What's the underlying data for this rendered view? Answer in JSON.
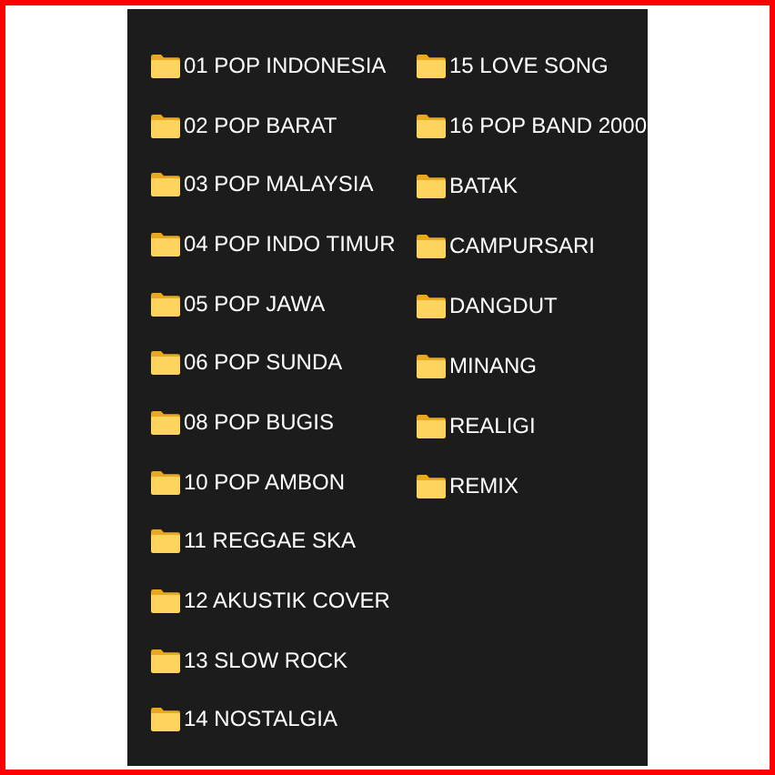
{
  "columns": [
    {
      "folders": [
        "01 POP INDONESIA",
        "02 POP BARAT",
        "03 POP MALAYSIA",
        "04 POP INDO TIMUR",
        "05 POP JAWA",
        "06 POP SUNDA",
        "08 POP BUGIS",
        "10 POP AMBON",
        "11 REGGAE SKA",
        "12 AKUSTIK COVER",
        "13 SLOW ROCK",
        "14 NOSTALGIA"
      ]
    },
    {
      "folders": [
        "15 LOVE SONG",
        "16 POP BAND 2000",
        "BATAK",
        "CAMPURSARI",
        "DANGDUT",
        "MINANG",
        "REALIGI",
        "REMIX"
      ]
    }
  ]
}
